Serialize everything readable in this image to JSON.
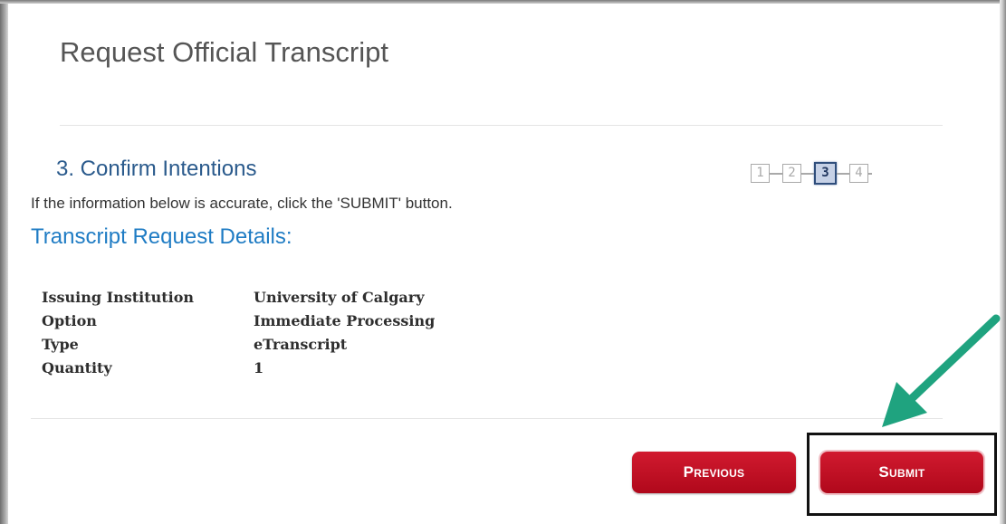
{
  "page": {
    "title": "Request Official Transcript"
  },
  "step": {
    "title": "3. Confirm Intentions",
    "instruction": "If the information below is accurate, click the 'SUBMIT' button.",
    "stepper": [
      "1",
      "2",
      "3",
      "4"
    ],
    "current_step": 3
  },
  "details": {
    "heading": "Transcript Request Details:",
    "rows": [
      {
        "label": "Issuing Institution",
        "value": "University of Calgary"
      },
      {
        "label": "Option",
        "value": "Immediate Processing"
      },
      {
        "label": "Type",
        "value": "eTranscript"
      },
      {
        "label": "Quantity",
        "value": "1"
      }
    ]
  },
  "buttons": {
    "previous_label": "Previous",
    "submit_label": "Submit"
  },
  "colors": {
    "button_red": "#c8102e",
    "heading_blue": "#1f7cc4",
    "step_title_blue": "#2a5a8c",
    "arrow_green": "#1fa37f"
  },
  "annotation": {
    "arrow_icon": "arrow-down-left-icon",
    "highlight": "submit-button-highlight"
  }
}
